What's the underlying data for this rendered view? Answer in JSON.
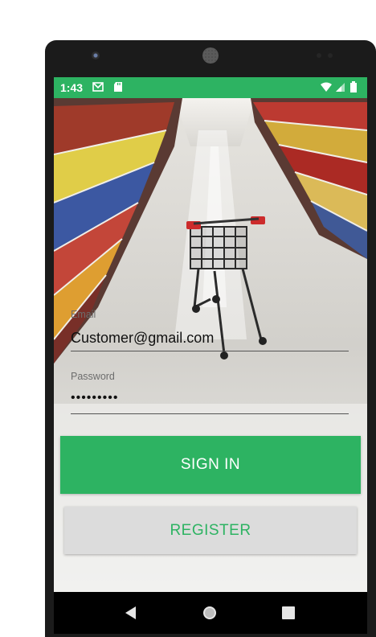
{
  "status_bar": {
    "time": "1:43",
    "color": "#2db362",
    "icons": [
      "gmail-icon",
      "sd-card-icon",
      "wifi-icon",
      "signal-icon",
      "battery-icon"
    ]
  },
  "background": {
    "description_icon": "grocery-aisle-shopping-cart-image"
  },
  "login_form": {
    "email_label": "Email",
    "email_value": "Customer@gmail.com",
    "password_label": "Password",
    "password_value": "•••••••••"
  },
  "buttons": {
    "sign_in": "SIGN IN",
    "register": "REGISTER"
  },
  "nav_bar": {
    "icons": [
      "back-icon",
      "home-icon",
      "recents-icon"
    ]
  },
  "theme": {
    "accent": "#2db362",
    "register_bg": "#dcdcdc"
  }
}
